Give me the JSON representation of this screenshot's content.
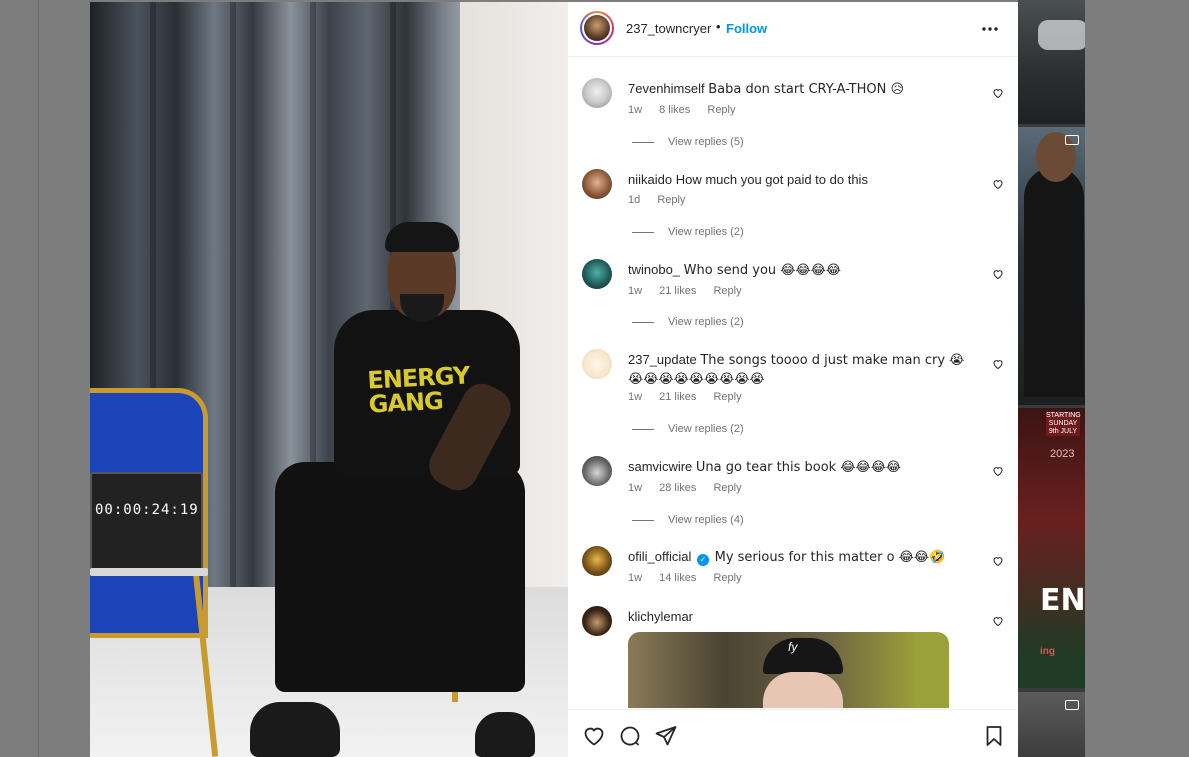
{
  "post": {
    "username": "237_towncryer",
    "separator": "•",
    "follow_label": "Follow",
    "more_label": "•••"
  },
  "media": {
    "timer_text": "00:00:24:19",
    "shirt_line1": "ENERGY",
    "shirt_line2": "GANG"
  },
  "comments": [
    {
      "user": "7evenhimself",
      "text": "Baba don start CRY-A-THON 😥",
      "time": "1w",
      "likes": "8 likes",
      "reply": "Reply",
      "replies": "View replies (5)"
    },
    {
      "user": "niikaido",
      "text": "How much you got paid to do this",
      "time": "1d",
      "likes": "",
      "reply": "Reply",
      "replies": "View replies (2)"
    },
    {
      "user": "twinobo_",
      "text": "Who send you 😂😂😂😂",
      "time": "1w",
      "likes": "21 likes",
      "reply": "Reply",
      "replies": "View replies (2)"
    },
    {
      "user": "237_update",
      "text": "The songs toooo d just make man cry 😭😭😭😭😭😭😭😭😭😭",
      "time": "1w",
      "likes": "21 likes",
      "reply": "Reply",
      "replies": "View replies (2)"
    },
    {
      "user": "samvicwire",
      "text": "Una go tear this book 😂😂😂😂",
      "time": "1w",
      "likes": "28 likes",
      "reply": "Reply",
      "replies": "View replies (4)"
    },
    {
      "user": "ofili_official",
      "text": "My serious for this matter o 😂😂🤣",
      "time": "1w",
      "likes": "14 likes",
      "reply": "Reply",
      "replies": ""
    },
    {
      "user": "klichylemar",
      "text": "",
      "gif_cap": "fy"
    }
  ],
  "right_thumbs": {
    "starting_label": "STARTING SUNDAY 9th JULY",
    "year": "2023",
    "big_text": "EN",
    "sub_text": "ing"
  },
  "icons": [
    "heart-icon",
    "comment-icon",
    "share-icon",
    "bookmark-icon",
    "more-icon",
    "verified-icon"
  ]
}
